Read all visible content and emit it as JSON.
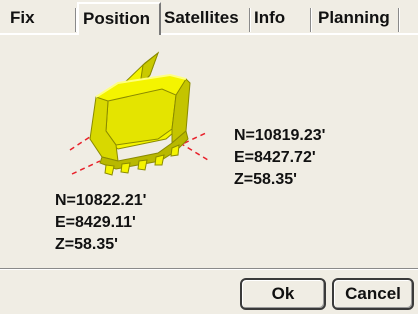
{
  "tabs": [
    {
      "label": "Fix"
    },
    {
      "label": "Position"
    },
    {
      "label": "Satellites"
    },
    {
      "label": "Info"
    },
    {
      "label": "Planning"
    }
  ],
  "active_tab": "Position",
  "point_right": {
    "n": "N=10819.23'",
    "e": "E=8427.72'",
    "z": "Z=58.35'"
  },
  "point_left": {
    "n": "N=10822.21'",
    "e": "E=8429.11'",
    "z": "Z=58.35'"
  },
  "buttons": {
    "ok": "Ok",
    "cancel": "Cancel"
  },
  "colors": {
    "bucket": "#f4f400",
    "bucket_dark": "#a9a900",
    "edge_line": "#e8202a",
    "background": "#f0ede4"
  },
  "icons": {
    "bucket": "excavator-bucket-icon"
  }
}
